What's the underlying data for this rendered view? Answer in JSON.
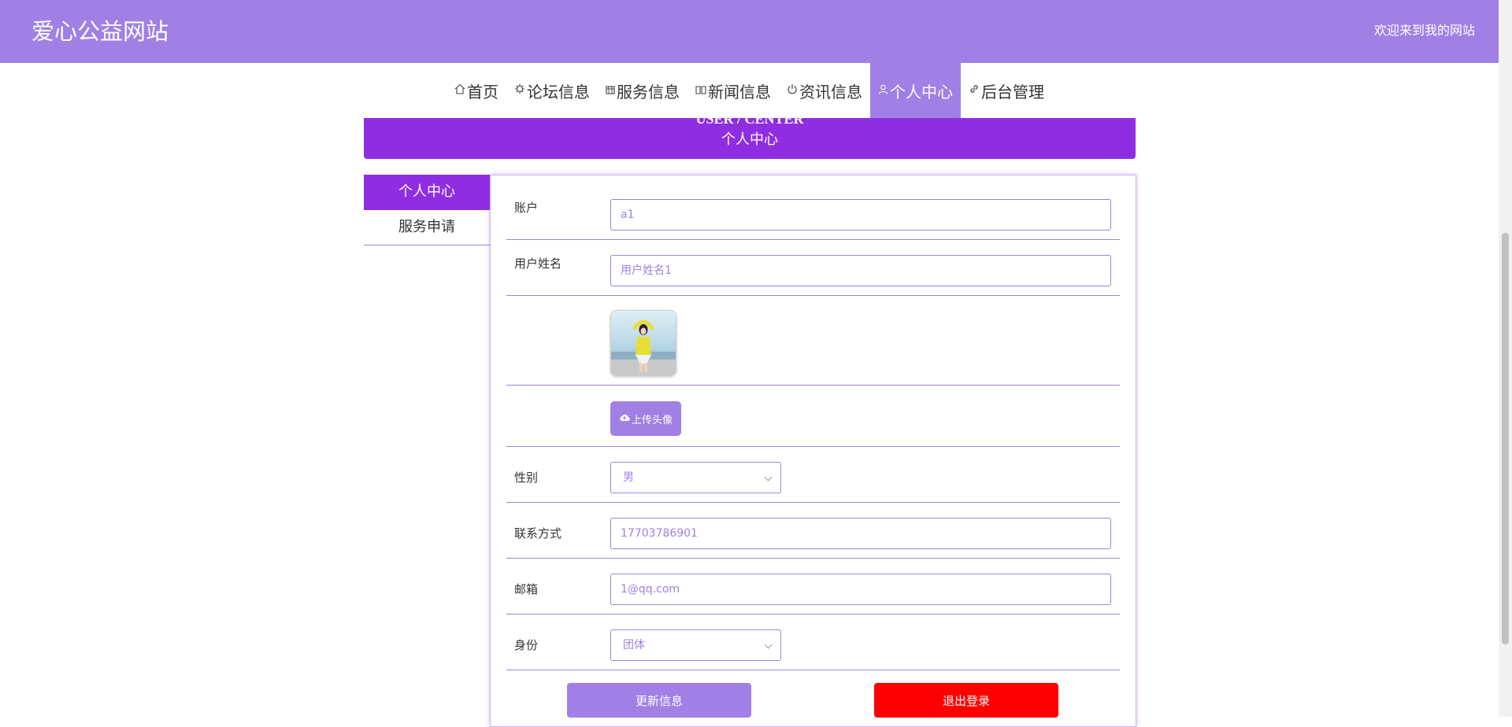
{
  "header": {
    "site_title": "爱心公益网站",
    "welcome": "欢迎来到我的网站",
    "bg_color": "#a080e4"
  },
  "nav": {
    "items": [
      {
        "label": "首页",
        "icon": "home-icon"
      },
      {
        "label": "论坛信息",
        "icon": "gear-icon"
      },
      {
        "label": "服务信息",
        "icon": "grid-icon"
      },
      {
        "label": "新闻信息",
        "icon": "book-icon"
      },
      {
        "label": "资讯信息",
        "icon": "power-icon"
      },
      {
        "label": "个人中心",
        "icon": "user-icon",
        "active": true
      },
      {
        "label": "后台管理",
        "icon": "link-icon"
      }
    ]
  },
  "banner": {
    "title_en": "USER / CENTER",
    "title_zh": "个人中心",
    "color": "#8f2de3"
  },
  "sidebar": {
    "items": [
      {
        "label": "个人中心",
        "active": true
      },
      {
        "label": "服务申请",
        "active": false
      }
    ]
  },
  "form": {
    "account": {
      "label": "账户",
      "value": "a1"
    },
    "username": {
      "label": "用户姓名",
      "value": "用户姓名1"
    },
    "upload_label": "上传头像",
    "gender": {
      "label": "性别",
      "value": "男"
    },
    "phone": {
      "label": "联系方式",
      "value": "17703786901"
    },
    "email": {
      "label": "邮箱",
      "value": "1@qq.com"
    },
    "identity": {
      "label": "身份",
      "value": "团体"
    }
  },
  "buttons": {
    "update": "更新信息",
    "logout": "退出登录",
    "update_color": "#a080e4",
    "logout_color": "#ff0000"
  }
}
